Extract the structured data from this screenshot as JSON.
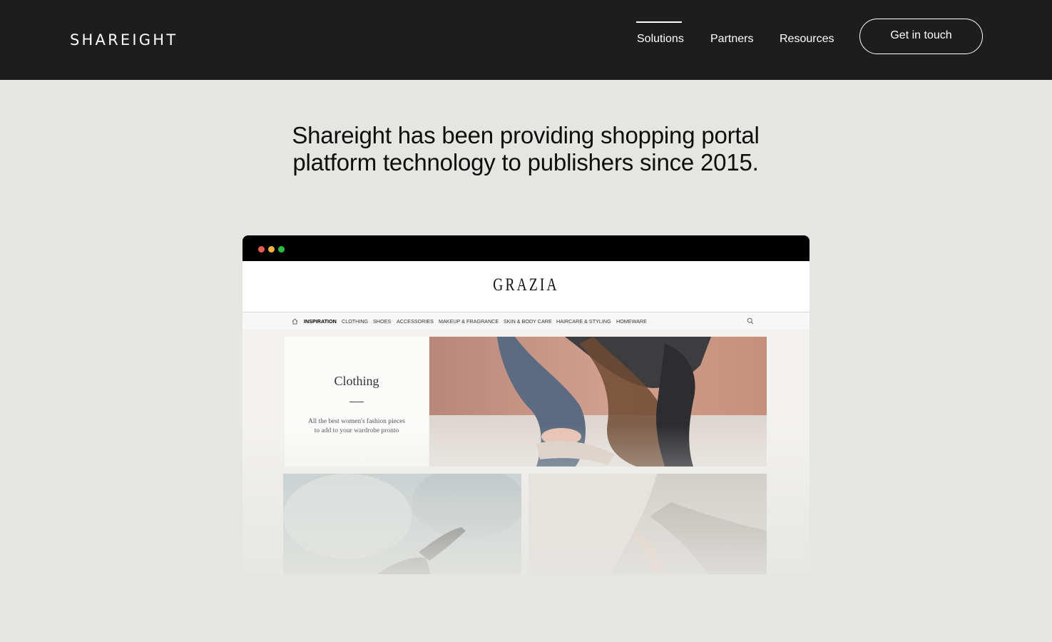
{
  "header": {
    "logo": "SHAREIGHT",
    "nav": [
      {
        "label": "Solutions",
        "active": true
      },
      {
        "label": "Partners",
        "active": false
      },
      {
        "label": "Resources",
        "active": false
      }
    ],
    "cta_label": "Get in touch"
  },
  "hero": {
    "line1": "Shareight has been providing shopping portal",
    "line2": "platform technology to publishers since 2015."
  },
  "mockup": {
    "window_dots": [
      "#ee5a52",
      "#f3b43a",
      "#29c141"
    ],
    "site_logo": "GRAZIA",
    "site_nav": [
      "INSPIRATION",
      "CLOTHING",
      "SHOES",
      "ACCESSORIES",
      "MAKEUP & FRAGRANCE",
      "SKIN & BODY CARE",
      "HAIRCARE & STYLING",
      "HOMEWARE"
    ],
    "category_title": "Clothing",
    "category_sub_1": "All the best women's fashion pieces",
    "category_sub_2": "to add to your wardrobe pronto"
  },
  "colors": {
    "header_bg": "#1d1d1d",
    "page_bg": "#e5e5e1"
  }
}
